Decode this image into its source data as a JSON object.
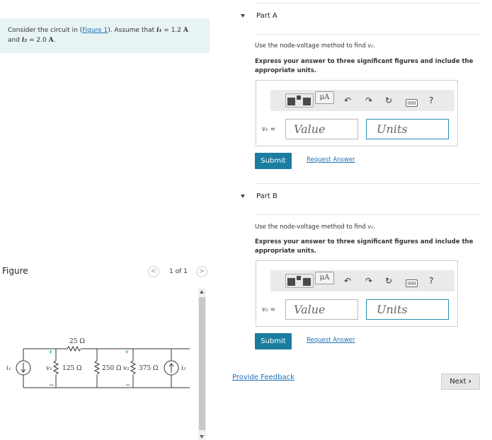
{
  "problem": {
    "prefix": "Consider the circuit in (",
    "figure_link": "Figure 1",
    "suffix": "). Assume that ",
    "i1_var": "i₁",
    "i1_eq": " = 1.2 ",
    "i1_unit": "A",
    "and": "and ",
    "i2_var": "i₂",
    "i2_eq": " = 2.0 ",
    "i2_unit": "A",
    "end": "."
  },
  "figure": {
    "title": "Figure",
    "pager": "1 of 1",
    "circuit": {
      "r_top": "25 Ω",
      "r1": "125 Ω",
      "r2": "250 Ω",
      "r3": "375 Ω",
      "v1": "v₁",
      "v2": "v₂",
      "i1": "i₁",
      "i2": "i₂",
      "plus": "+",
      "minus": "−"
    }
  },
  "parts": [
    {
      "label": "Part A",
      "instruction_prefix": "Use the node-voltage method to find ",
      "instruction_var": "v₁",
      "instruction_suffix": ".",
      "bold_instruction": "Express your answer to three significant figures and include the appropriate units.",
      "toolbar": {
        "units_symbol": "μA",
        "help": "?"
      },
      "var_label": "v₁",
      "equals": " =",
      "value_placeholder": "Value",
      "units_placeholder": "Units",
      "submit": "Submit",
      "request_answer": "Request Answer"
    },
    {
      "label": "Part B",
      "instruction_prefix": "Use the node-voltage method to find ",
      "instruction_var": "v₂",
      "instruction_suffix": ".",
      "bold_instruction": "Express your answer to three significant figures and include the appropriate units.",
      "toolbar": {
        "units_symbol": "μA",
        "help": "?"
      },
      "var_label": "v₂",
      "equals": " =",
      "value_placeholder": "Value",
      "units_placeholder": "Units",
      "submit": "Submit",
      "request_answer": "Request Answer"
    }
  ],
  "footer": {
    "feedback": "Provide Feedback",
    "next": "Next",
    "next_icon": "chevron-right-icon"
  }
}
